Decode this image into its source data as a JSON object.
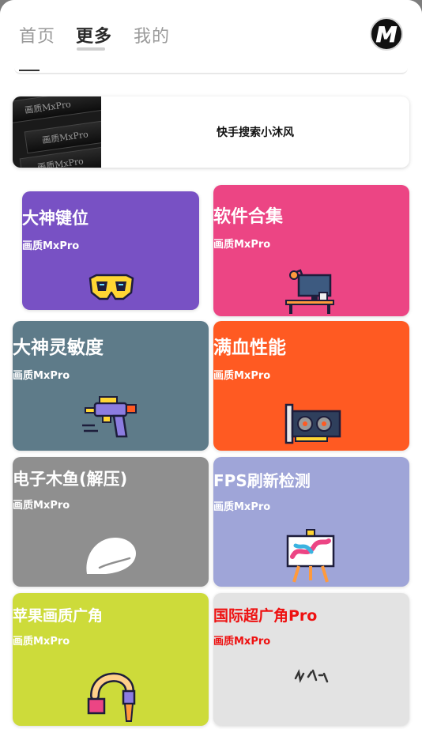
{
  "tabs": [
    {
      "label": "首页",
      "active": false
    },
    {
      "label": "更多",
      "active": true
    },
    {
      "label": "我的",
      "active": false
    }
  ],
  "avatar": {
    "letter": "M"
  },
  "banner": {
    "thumb_text": "画质MxPro",
    "label": "快手搜索小沐风"
  },
  "cards": [
    {
      "title": "大神键位",
      "subtitle": "画质MxPro",
      "color": "#7851c4",
      "title_color": "#ffffff",
      "icon": "goggles-icon"
    },
    {
      "title": "软件合集",
      "subtitle": "画质MxPro",
      "color": "#ec4584",
      "title_color": "#ffffff",
      "icon": "desk-computer-icon"
    },
    {
      "title": "大神灵敏度",
      "subtitle": "画质MxPro",
      "color": "#5e7b89",
      "title_color": "#ffffff",
      "icon": "blaster-gun-icon"
    },
    {
      "title": "满血性能",
      "subtitle": "画质MxPro",
      "color": "#ff5a22",
      "title_color": "#ffffff",
      "icon": "graphics-card-icon"
    },
    {
      "title": "电子木鱼(解压)",
      "subtitle": "画质MxPro",
      "color": "#8f8f8f",
      "title_color": "#ffffff",
      "icon": "wooden-fish-icon"
    },
    {
      "title": "FPS刷新检测",
      "subtitle": "画质MxPro",
      "color": "#9fa5d8",
      "title_color": "#ffffff",
      "icon": "easel-painting-icon"
    },
    {
      "title": "苹果画质广角",
      "subtitle": "画质MxPro",
      "color": "#cddb3a",
      "title_color": "#ffffff",
      "icon": "paint-brush-icon"
    },
    {
      "title": "国际超广角Pro",
      "subtitle": "画质MxPro",
      "color": "#e3e3e3",
      "title_color": "#ee1111",
      "icon": "sketch-icon"
    }
  ]
}
